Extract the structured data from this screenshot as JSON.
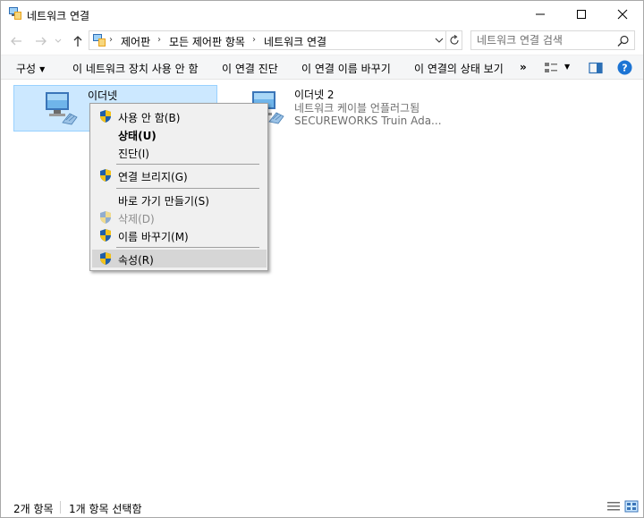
{
  "window": {
    "title": "네트워크 연결"
  },
  "address": {
    "crumbs": [
      "제어판",
      "모든 제어판 항목",
      "네트워크 연결"
    ]
  },
  "search": {
    "placeholder": "네트워크 연결 검색"
  },
  "commands": {
    "organize": "구성",
    "disable": "이 네트워크 장치 사용 안 함",
    "diagnose": "이 연결 진단",
    "rename": "이 연결 이름 바꾸기",
    "status": "이 연결의 상태 보기",
    "more": "»"
  },
  "adapters": [
    {
      "name": "이더넷",
      "status": "",
      "device": ""
    },
    {
      "name": "이더넷 2",
      "status": "네트워크 케이블 언플러그됨",
      "device": "SECUREWORKS Truin Ada..."
    }
  ],
  "context_menu": {
    "items": [
      {
        "label": "사용 안 함(B)"
      },
      {
        "label": "상태(U)"
      },
      {
        "label": "진단(I)"
      },
      {
        "label": "연결 브리지(G)"
      },
      {
        "label": "바로 가기 만들기(S)"
      },
      {
        "label": "삭제(D)"
      },
      {
        "label": "이름 바꾸기(M)"
      },
      {
        "label": "속성(R)"
      }
    ]
  },
  "statusbar": {
    "count": "2개 항목",
    "selected": "1개 항목 선택함"
  },
  "colors": {
    "selection_bg": "#cce8ff",
    "selection_border": "#99d1ff",
    "help_blue": "#1c74d4",
    "menu_bg": "#f0f0f0"
  }
}
